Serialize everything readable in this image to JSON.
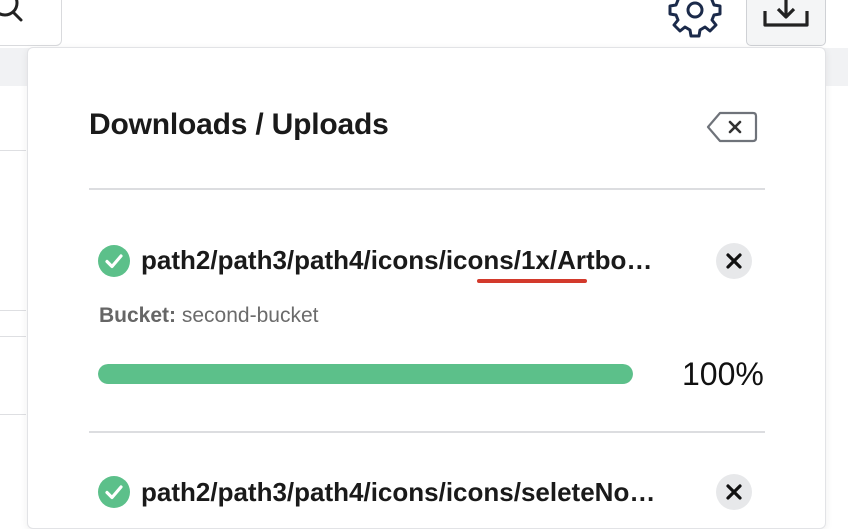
{
  "toolbar": {
    "search_icon": "search-icon",
    "settings_icon": "gear-icon",
    "upload_icon": "upload-tray-icon"
  },
  "panel": {
    "title": "Downloads / Uploads",
    "clear_icon": "backspace-clear-icon",
    "items": [
      {
        "status_icon": "check-circle-icon",
        "path": "path2/path3/path4/icons/icons/1x/Artbo…",
        "bucket_label": "Bucket:",
        "bucket": "second-bucket",
        "progress": 100,
        "progress_text": "100%",
        "remove_icon": "close-icon"
      },
      {
        "status_icon": "check-circle-icon",
        "path": "path2/path3/path4/icons/icons/seleteNo…",
        "remove_icon": "close-icon"
      }
    ]
  },
  "colors": {
    "success": "#5cc08a",
    "progress_track": "#e6e7ea",
    "annotation_underline": "#d33a2c",
    "text": "#1a1a1a"
  }
}
